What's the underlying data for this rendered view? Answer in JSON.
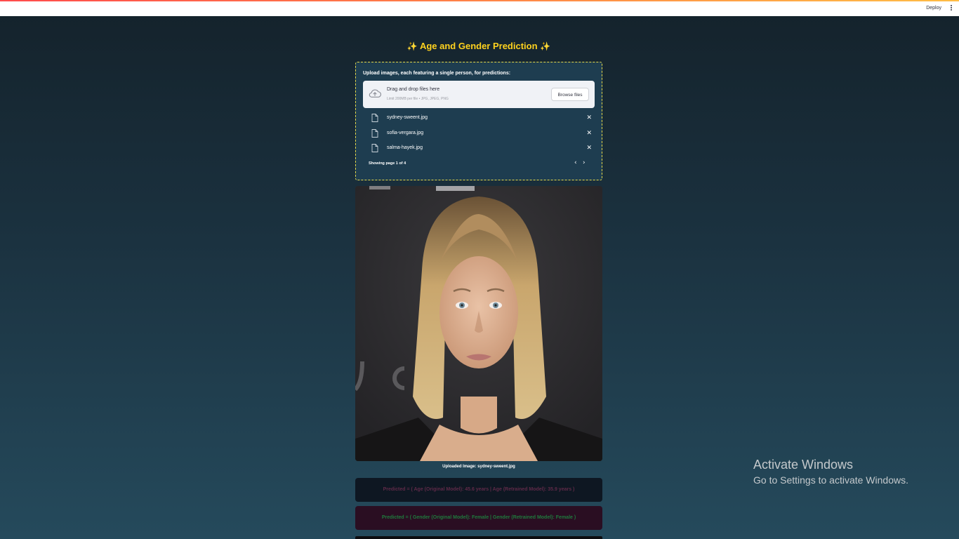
{
  "header": {
    "deploy_label": "Deploy"
  },
  "title": {
    "text": "Age and Gender Prediction",
    "emoji": "✨"
  },
  "uploader": {
    "label": "Upload images, each featuring a single person, for predictions:",
    "drop_title": "Drag and drop files here",
    "drop_limit": "Limit 200MB per file • JPG, JPEG, PNG",
    "browse_label": "Browse files",
    "files": [
      {
        "name": "sydney-sweent.jpg"
      },
      {
        "name": "sofia-vergara.jpg"
      },
      {
        "name": "salma-hayek.jpg"
      }
    ],
    "pager_text": "Showing page 1 of 4"
  },
  "result": {
    "caption": "Uploaded Image: sydney-sweent.jpg",
    "age_text": "Predicted = ( Age (Original Model): 45.6 years | Age (Retrained Model): 35.9 years )",
    "gender_text": "Predicted = ( Gender (Original Model): Female | Gender (Retrained Model): Female )"
  },
  "watermark": {
    "line1": "Activate Windows",
    "line2": "Go to Settings to activate Windows."
  },
  "colors": {
    "accent": "#ffd21e",
    "topbar_stripe": "#ff4b4b"
  }
}
